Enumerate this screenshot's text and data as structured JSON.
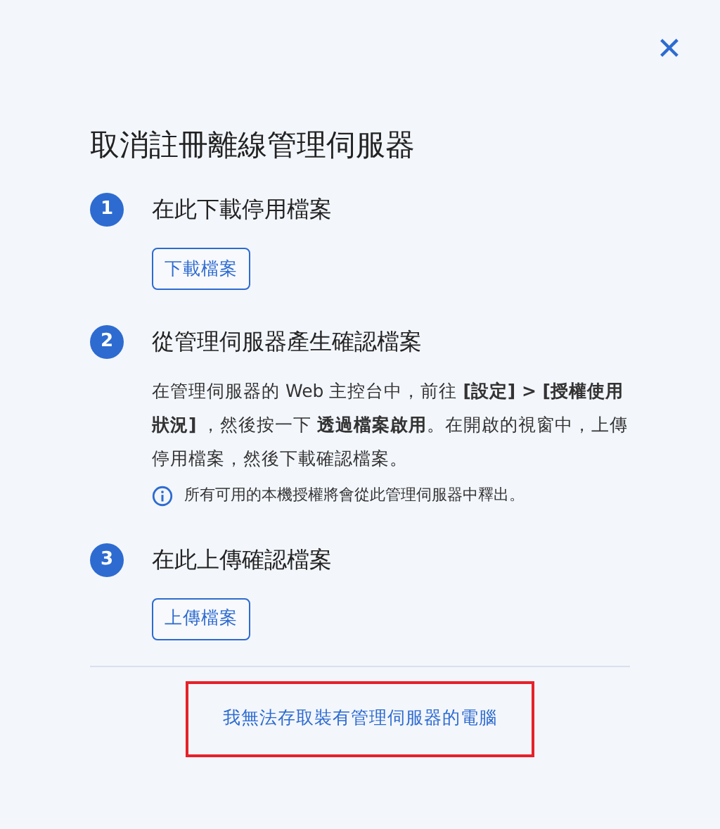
{
  "dialog": {
    "title": "取消註冊離線管理伺服器",
    "close_glyph": "✕"
  },
  "steps": [
    {
      "number": "1",
      "title": "在此下載停用檔案",
      "button": "下載檔案"
    },
    {
      "number": "2",
      "title": "從管理伺服器產生確認檔案",
      "description": "在管理伺服器的 Web 主控台中，前往 **[設定] > [授權使用狀況]** ，然後按一下 **透過檔案啟用**。在開啟的視窗中，上傳停用檔案，然後下載確認檔案。",
      "note": "所有可用的本機授權將會從此管理伺服器中釋出。"
    },
    {
      "number": "3",
      "title": "在此上傳確認檔案",
      "button": "上傳檔案"
    }
  ],
  "footer_link": {
    "label": "我無法存取裝有管理伺服器的電腦",
    "highlighted": true
  }
}
